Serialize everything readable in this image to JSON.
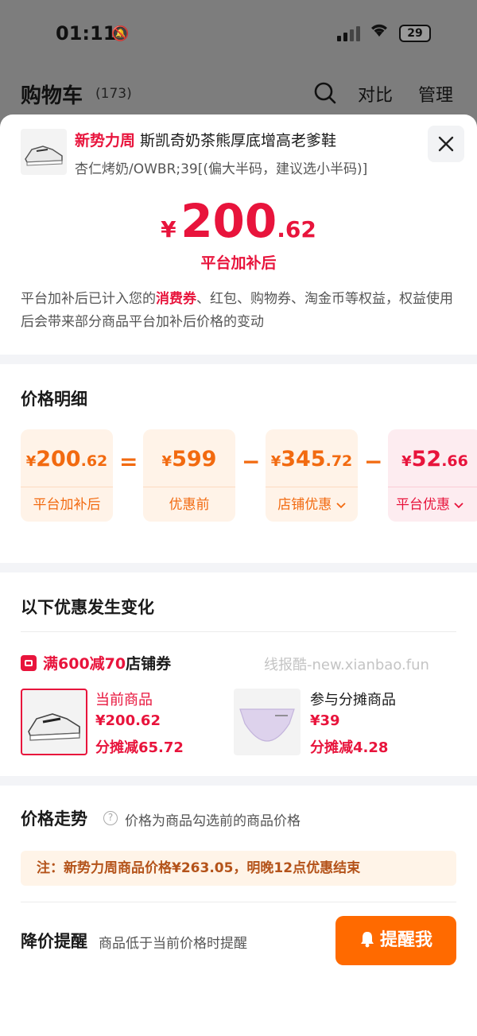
{
  "status_bar": {
    "time": "01:11",
    "battery": "29"
  },
  "header": {
    "title": "购物车",
    "count": "(173)",
    "compare": "对比",
    "manage": "管理"
  },
  "product": {
    "tag": "新势力周",
    "name": "斯凯奇奶茶熊厚底增高老爹鞋",
    "sku": "杏仁烤奶/OWBR;39[(偏大半码，建议选小半码)]"
  },
  "final_price": {
    "yen": "¥",
    "int": "200",
    "dec": ".62",
    "label": "平台加补后"
  },
  "note": {
    "part1": "平台加补后已计入您的",
    "highlight": "消费券",
    "part2": "、红包、购物券、淘金币等权益，权益使用后会带来部分商品平台加补后价格的变动"
  },
  "price_detail": {
    "title": "价格明细",
    "cards": [
      {
        "yen": "¥",
        "int": "200",
        "dec": ".62",
        "label": "平台加补后"
      },
      {
        "yen": "¥",
        "int": "599",
        "dec": "",
        "label": "优惠前"
      },
      {
        "yen": "¥",
        "int": "345",
        "dec": ".72",
        "label": "店铺优惠"
      },
      {
        "yen": "¥",
        "int": "52",
        "dec": ".66",
        "label": "平台优惠"
      }
    ],
    "ops": [
      "=",
      "−",
      "−"
    ]
  },
  "discount_change": {
    "title": "以下优惠发生变化",
    "coupon_prefix": "满600减70",
    "coupon_suffix": "店铺券",
    "watermark": "线报酷-new.xianbao.fun",
    "items": [
      {
        "label": "当前商品",
        "price": "¥200.62",
        "share": "分摊减65.72"
      },
      {
        "label": "参与分摊商品",
        "price": "¥39",
        "share": "分摊减4.28"
      }
    ]
  },
  "trend": {
    "title": "价格走势",
    "desc": "价格为商品勾选前的商品价格",
    "notice": "注：新势力周商品价格¥263.05，明晚12点优惠结束"
  },
  "remind": {
    "title": "降价提醒",
    "desc": "商品低于当前价格时提醒",
    "button": "提醒我"
  },
  "colors": {
    "accent_red": "#e8143c",
    "accent_orange": "#f26a10",
    "button_orange": "#ff6a00"
  }
}
